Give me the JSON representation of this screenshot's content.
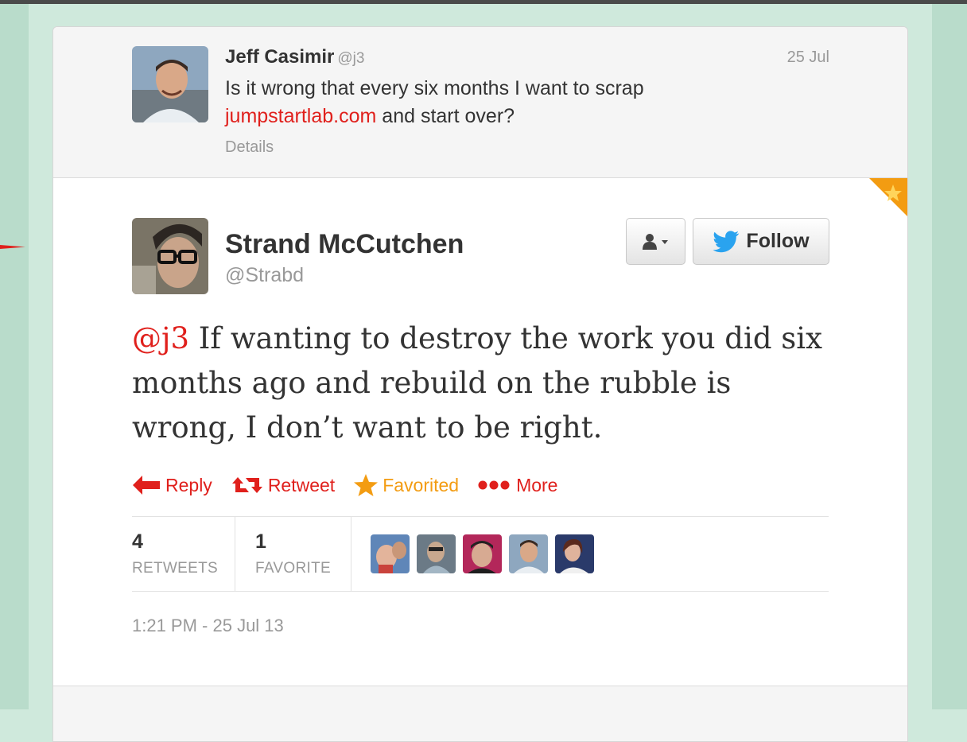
{
  "parent_tweet": {
    "author_name": "Jeff Casimir",
    "author_handle": "@j3",
    "date": "25 Jul",
    "text_before_link": "Is it wrong that every six months I want to scrap ",
    "link_text": "jumpstartlab.com",
    "text_after_link": " and start over?",
    "details_label": "Details"
  },
  "tweet": {
    "author_name": "Strand McCutchen",
    "author_handle": "@Strabd",
    "mention": "@j3",
    "text": " If wanting to destroy the work you did six months ago and rebuild on the rubble is wrong, I don’t want to be right.",
    "timestamp": "1:21 PM - 25 Jul 13"
  },
  "buttons": {
    "user_menu_icon": "user-dropdown-icon",
    "follow_label": "Follow"
  },
  "actions": {
    "reply": "Reply",
    "retweet": "Retweet",
    "favorited": "Favorited",
    "more": "More"
  },
  "stats": {
    "retweets_count": "4",
    "retweets_label": "RETWEETS",
    "favorites_count": "1",
    "favorites_label": "FAVORITE"
  },
  "colors": {
    "link": "#e0201c",
    "favorited": "#f39c12",
    "background": "#cfe9dc",
    "twitter_blue": "#2aa3ef"
  }
}
